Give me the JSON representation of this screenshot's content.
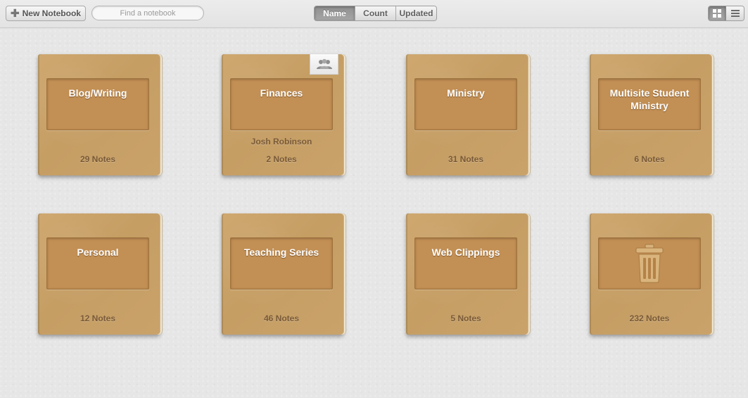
{
  "toolbar": {
    "new_notebook_label": "New Notebook",
    "search_placeholder": "Find a notebook",
    "sort_options": [
      "Name",
      "Count",
      "Updated"
    ],
    "active_sort": "Name",
    "view_modes": [
      "grid-view-icon",
      "list-view-icon"
    ],
    "active_view": "grid-view-icon"
  },
  "notebooks": [
    {
      "title": "Blog/Writing",
      "count": "29 Notes"
    },
    {
      "title": "Finances",
      "owner": "Josh Robinson",
      "count": "2 Notes",
      "shared": true
    },
    {
      "title": "Ministry",
      "count": "31 Notes"
    },
    {
      "title": "Multisite Student Ministry",
      "count": "6 Notes"
    },
    {
      "title": "Personal",
      "count": "12 Notes"
    },
    {
      "title": "Teaching Series",
      "count": "46 Notes"
    },
    {
      "title": "Web Clippings",
      "count": "5 Notes"
    },
    {
      "title": "",
      "icon": "trash-icon",
      "count": "232 Notes"
    }
  ],
  "colors": {
    "notebook_cover": "#c9a26a",
    "label_box": "#c28f54",
    "count_text": "#7a5a37",
    "background": "#e6e6e6"
  }
}
